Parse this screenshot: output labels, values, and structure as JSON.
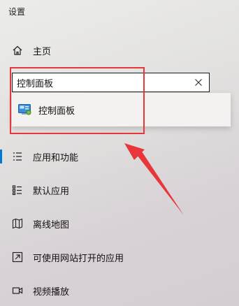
{
  "window": {
    "title": "设置"
  },
  "nav": {
    "home_label": "主页",
    "items": [
      {
        "label": "应用和功能",
        "icon": "apps-features-icon",
        "selected": true
      },
      {
        "label": "默认应用",
        "icon": "default-apps-icon",
        "selected": false
      },
      {
        "label": "离线地图",
        "icon": "offline-maps-icon",
        "selected": false
      },
      {
        "label": "可使用网站打开的应用",
        "icon": "apps-for-websites-icon",
        "selected": false
      },
      {
        "label": "视频播放",
        "icon": "video-playback-icon",
        "selected": false
      }
    ]
  },
  "search": {
    "value": "控制面板",
    "suggestions": [
      {
        "label": "控制面板",
        "icon": "control-panel-icon"
      }
    ]
  },
  "colors": {
    "accent": "#0078d4",
    "highlight": "#e8373b"
  }
}
